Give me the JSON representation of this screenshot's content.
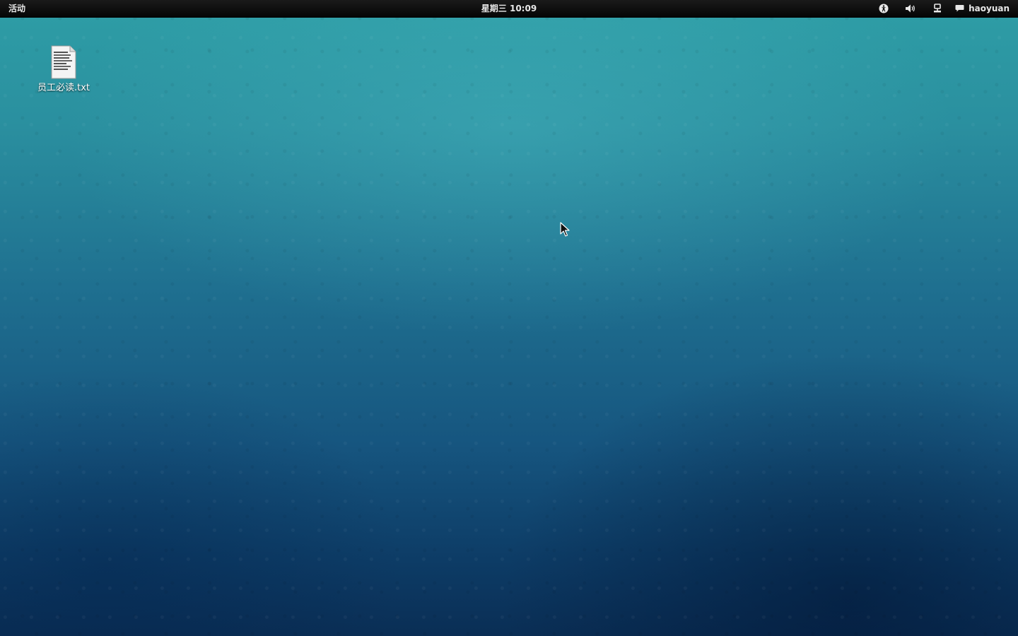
{
  "topbar": {
    "activities_label": "活动",
    "clock_label": "星期三 10:09",
    "tray": {
      "accessibility_icon": "accessibility-icon",
      "volume_icon": "speaker-volume-icon",
      "network_icon": "network-wired-icon",
      "chat_icon": "chat-bubble-icon"
    },
    "user_name": "haoyuan"
  },
  "desktop": {
    "files": [
      {
        "name": "员工必读.txt",
        "icon": "text-file-icon"
      }
    ]
  },
  "colors": {
    "topbar_bg": "#0a0a0a",
    "wallpaper_top": "#2e9ea6",
    "wallpaper_bottom": "#0a2e55"
  }
}
